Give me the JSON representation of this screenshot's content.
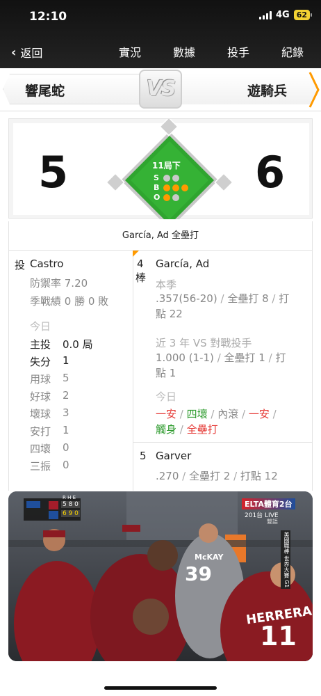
{
  "status": {
    "time": "12:10",
    "network": "4G",
    "battery": "62"
  },
  "nav": {
    "back_label": "返回",
    "tabs": [
      {
        "label": "實況",
        "active": true
      },
      {
        "label": "數據",
        "active": false
      },
      {
        "label": "投手",
        "active": false
      },
      {
        "label": "紀錄",
        "active": false
      }
    ]
  },
  "teams": {
    "away": "響尾蛇",
    "home": "遊騎兵",
    "vs": "VS"
  },
  "score": {
    "away": "5",
    "home": "6",
    "inning": "11局下"
  },
  "count": {
    "labels": [
      "S",
      "B",
      "O"
    ],
    "strikes": 0,
    "balls": 3,
    "outs": 1,
    "colors": {
      "ball": "#ff9a00",
      "strike": "#ff9a00",
      "out": "#ff9a00",
      "off": "#c9c9c9"
    }
  },
  "play_text": "García, Ad 全壘打",
  "pitcher": {
    "role": "投",
    "name": "Castro",
    "era": "防禦率 7.20",
    "record": "季戰績 0 勝 0 敗",
    "today_label": "今日",
    "stats": [
      {
        "label": "主投",
        "value": "0.0 局",
        "bold": true
      },
      {
        "label": "失分",
        "value": "1",
        "bold": true
      },
      {
        "label": "用球",
        "value": "5",
        "bold": false
      },
      {
        "label": "好球",
        "value": "2",
        "bold": false
      },
      {
        "label": "壞球",
        "value": "3",
        "bold": false
      },
      {
        "label": "安打",
        "value": "1",
        "bold": false
      },
      {
        "label": "四壞",
        "value": "0",
        "bold": false
      },
      {
        "label": "三振",
        "value": "0",
        "bold": false
      }
    ]
  },
  "batter": {
    "order_num": "4",
    "order_char": "棒",
    "name": "García, Ad",
    "season_label": "本季",
    "season_line1_a": ".357(56-20)",
    "season_line1_b": "全壘打 8",
    "season_line1_c": "打",
    "season_line2": "點 22",
    "vs_label": "近 3 年 VS 對戰投手",
    "vs_line1_a": "1.000 (1-1)",
    "vs_line1_b": "全壘打 1",
    "vs_line1_c": "打",
    "vs_line2": "點 1",
    "today_label": "今日",
    "today_row1": [
      "一安",
      "四壞",
      "內滾",
      "一安"
    ],
    "today_row2": [
      "觸身",
      "全壘打"
    ]
  },
  "next_batter": {
    "order_num": "5",
    "name": "Garver",
    "line_a": ".270",
    "line_b": "全壘打 2",
    "line_c": "打點 12"
  },
  "video": {
    "scorebox": {
      "header": "R H E",
      "away_line": "5 8 0",
      "home_line": "6 9 0"
    },
    "channel": "ELTA體育2台",
    "live": "201台 LIVE",
    "dual": "雙語",
    "side_text": "美國職棒 世界大賽 G1",
    "player1_name": "McKAY",
    "player1_num": "39",
    "player2_name": "HERRERA",
    "player2_num": "11"
  }
}
